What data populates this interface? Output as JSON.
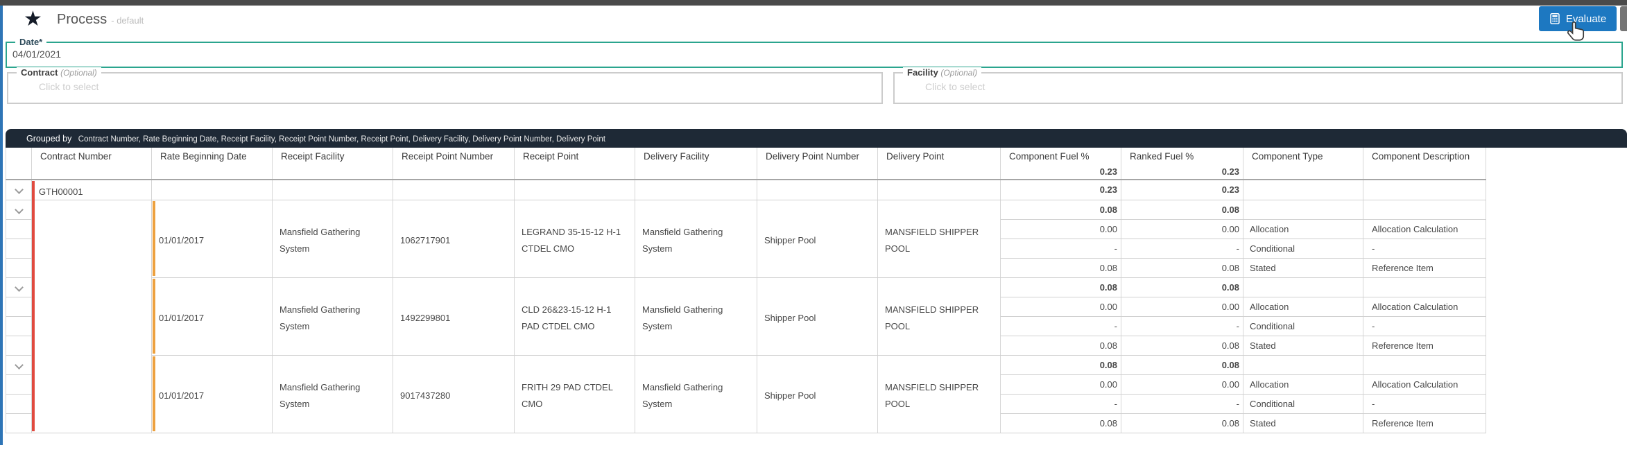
{
  "colors": {
    "accent_blue": "#1d78c1",
    "teal_border": "#2ba58e",
    "dark_bar": "#1e2936",
    "contract_group_bar": "#e04a3f",
    "rate_group_bar": "#eda13f",
    "left_edge_blue": "#2e75b6"
  },
  "header": {
    "title": "Process",
    "subtitle": "- default",
    "evaluate_label": "Evaluate"
  },
  "form": {
    "date": {
      "label": "Date*",
      "value": "04/01/2021"
    },
    "contract": {
      "label": "Contract",
      "optional": "(Optional)",
      "placeholder": "Click to select"
    },
    "facility": {
      "label": "Facility",
      "optional": "(Optional)",
      "placeholder": "Click to select"
    }
  },
  "grouped_by": {
    "prefix": "Grouped by",
    "fields": "Contract Number, Rate Beginning Date, Receipt Facility, Receipt Point Number, Receipt Point, Delivery Facility, Delivery Point Number, Delivery Point"
  },
  "table": {
    "columns": [
      "Contract Number",
      "Rate Beginning Date",
      "Receipt Facility",
      "Receipt Point Number",
      "Receipt Point",
      "Delivery Facility",
      "Delivery Point Number",
      "Delivery Point",
      "Component Fuel %",
      "Ranked Fuel %",
      "Component Type",
      "Component Description"
    ],
    "totals": {
      "component_fuel": "0.23",
      "ranked_fuel": "0.23"
    },
    "contract_group": {
      "contract_number": "GTH00001",
      "component_fuel": "0.23",
      "ranked_fuel": "0.23"
    },
    "rate_groups": [
      {
        "rate_beginning_date": "01/01/2017",
        "receipt_facility": "Mansfield Gathering System",
        "receipt_point_number": "1062717901",
        "receipt_point": "LEGRAND 35-15-12 H-1 CTDEL CMO",
        "delivery_facility": "Mansfield Gathering System",
        "delivery_point_number": "Shipper Pool",
        "delivery_point": "MANSFIELD SHIPPER POOL",
        "component_fuel": "0.08",
        "ranked_fuel": "0.08",
        "components": [
          {
            "component_fuel": "0.00",
            "ranked_fuel": "0.00",
            "type": "Allocation",
            "description": "Allocation Calculation"
          },
          {
            "component_fuel": "-",
            "ranked_fuel": "-",
            "type": "Conditional",
            "description": "-"
          },
          {
            "component_fuel": "0.08",
            "ranked_fuel": "0.08",
            "type": "Stated",
            "description": "Reference Item"
          }
        ]
      },
      {
        "rate_beginning_date": "01/01/2017",
        "receipt_facility": "Mansfield Gathering System",
        "receipt_point_number": "1492299801",
        "receipt_point": "CLD 26&23-15-12 H-1 PAD CTDEL CMO",
        "delivery_facility": "Mansfield Gathering System",
        "delivery_point_number": "Shipper Pool",
        "delivery_point": "MANSFIELD SHIPPER POOL",
        "component_fuel": "0.08",
        "ranked_fuel": "0.08",
        "components": [
          {
            "component_fuel": "0.00",
            "ranked_fuel": "0.00",
            "type": "Allocation",
            "description": "Allocation Calculation"
          },
          {
            "component_fuel": "-",
            "ranked_fuel": "-",
            "type": "Conditional",
            "description": "-"
          },
          {
            "component_fuel": "0.08",
            "ranked_fuel": "0.08",
            "type": "Stated",
            "description": "Reference Item"
          }
        ]
      },
      {
        "rate_beginning_date": "01/01/2017",
        "receipt_facility": "Mansfield Gathering System",
        "receipt_point_number": "9017437280",
        "receipt_point": "FRITH 29 PAD CTDEL CMO",
        "delivery_facility": "Mansfield Gathering System",
        "delivery_point_number": "Shipper Pool",
        "delivery_point": "MANSFIELD SHIPPER POOL",
        "component_fuel": "0.08",
        "ranked_fuel": "0.08",
        "components": [
          {
            "component_fuel": "0.00",
            "ranked_fuel": "0.00",
            "type": "Allocation",
            "description": "Allocation Calculation"
          },
          {
            "component_fuel": "-",
            "ranked_fuel": "-",
            "type": "Conditional",
            "description": "-"
          },
          {
            "component_fuel": "0.08",
            "ranked_fuel": "0.08",
            "type": "Stated",
            "description": "Reference Item"
          }
        ]
      }
    ]
  }
}
